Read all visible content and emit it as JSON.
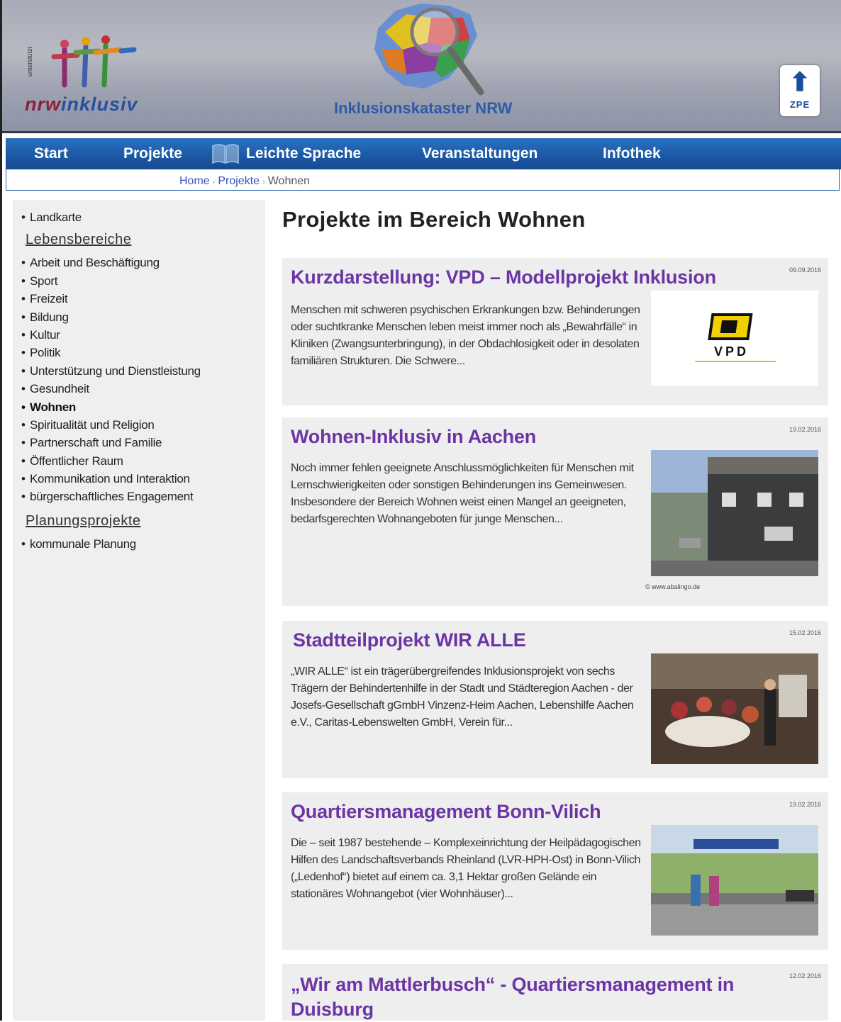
{
  "header": {
    "logo_text_a": "nrw",
    "logo_text_b": "inklusiv",
    "title": "Inklusionskataster NRW",
    "zpe_label": "ZPE"
  },
  "nav": {
    "items": [
      "Start",
      "Projekte",
      "Leichte Sprache",
      "Veranstaltungen",
      "Infothek"
    ]
  },
  "breadcrumb": [
    "Home",
    "Projekte",
    "Wohnen"
  ],
  "sidebar": {
    "top_item": "Landkarte",
    "heading1": "Lebensbereiche",
    "items": [
      "Arbeit und Beschäftigung",
      "Sport",
      "Freizeit",
      "Bildung",
      "Kultur",
      "Politik",
      "Unterstützung und Dienstleistung",
      "Gesundheit",
      "Wohnen",
      "Spiritualität und Religion",
      "Partnerschaft und Familie",
      "Öffentlicher Raum",
      "Kommunikation und Interaktion",
      "bürgerschaftliches Engagement"
    ],
    "heading2": "Planungsprojekte",
    "items2": [
      "kommunale Planung"
    ]
  },
  "main": {
    "title": "Projekte im Bereich Wohnen",
    "cards": [
      {
        "title": "Kurzdarstellung: VPD – Modellprojekt Inklusion",
        "date": "09.09.2016",
        "text": "Menschen mit schweren psychischen Erkrankungen bzw. Behinderungen oder suchtkranke Menschen leben meist immer noch als „Bewahrfälle“ in Kliniken (Zwangsunterbringung), in der Obdachlosigkeit oder in desolaten familiären Strukturen. Die Schwere...",
        "logo_text": "VPD"
      },
      {
        "title": "Wohnen-Inklusiv in Aachen",
        "date": "19.02.2016",
        "text": "Noch immer fehlen geeignete Anschlussmöglichkeiten für Menschen mit Lernschwierigkeiten oder sonstigen Behinderungen ins Gemeinwesen. Insbesondere der Bereich Wohnen weist einen Mangel an geeigneten, bedarfsgerechten Wohnangeboten für junge Menschen...",
        "credit": "© www.abalingo.de"
      },
      {
        "title": "Stadtteilprojekt WIR ALLE",
        "date": "15.02.2016",
        "text": "„WIR ALLE“ ist ein trägerübergreifendes Inklusionsprojekt von sechs Trägern der Behindertenhilfe in der Stadt und Städteregion Aachen - der Josefs-Gesellschaft gGmbH Vinzenz-Heim Aachen, Lebenshilfe Aachen e.V., Caritas-Lebenswelten GmbH, Verein für..."
      },
      {
        "title": "Quartiersmanagement Bonn-Vilich",
        "date": "19.02.2016",
        "text": "Die – seit 1987 bestehende – Komplexeinrichtung der Heilpädagogischen Hilfen des Landschaftsverbands Rheinland (LVR-HPH-Ost) in Bonn-Vilich („Ledenhof“) bietet auf einem ca. 3,1 Hektar großen Gelände ein stationäres Wohnangebot (vier Wohnhäuser)..."
      },
      {
        "title": "„Wir am Mattlerbusch“ - Quartiersmanagement in Duisburg",
        "date": "12.02.2016"
      }
    ]
  },
  "colors": {
    "nav": "#1c5aa6",
    "card_title": "#6c35a5",
    "card_bg": "#eeeeee",
    "sidebar_bg": "#efefef"
  }
}
